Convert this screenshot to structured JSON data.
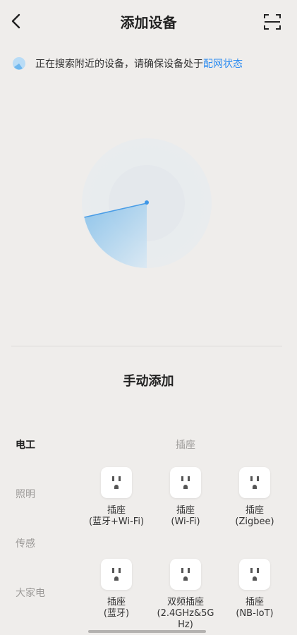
{
  "header": {
    "title": "添加设备",
    "back_icon": "back-arrow-icon",
    "scan_icon": "scan-icon"
  },
  "tip": {
    "text": "正在搜索附近的设备，请确保设备处于",
    "link": "配网状态"
  },
  "manual": {
    "title": "手动添加"
  },
  "categories": [
    {
      "label": "电工",
      "active": true
    },
    {
      "label": "照明",
      "active": false
    },
    {
      "label": "传感",
      "active": false
    },
    {
      "label": "大家电",
      "active": false
    }
  ],
  "section": {
    "title": "插座"
  },
  "devices": [
    {
      "line1": "插座",
      "line2": "(蓝牙+Wi-Fi)",
      "icon": "socket-icon"
    },
    {
      "line1": "插座",
      "line2": "(Wi-Fi)",
      "icon": "socket-icon"
    },
    {
      "line1": "插座",
      "line2": "(Zigbee)",
      "icon": "socket-icon"
    },
    {
      "line1": "插座",
      "line2": "(蓝牙)",
      "icon": "socket-icon"
    },
    {
      "line1": "双频插座",
      "line2": "(2.4GHz&5G",
      "line3": "Hz)",
      "icon": "socket-icon"
    },
    {
      "line1": "插座",
      "line2": "(NB-IoT)",
      "icon": "socket-icon"
    }
  ],
  "colors": {
    "accent": "#2d8cf0",
    "background": "#efedeb"
  }
}
